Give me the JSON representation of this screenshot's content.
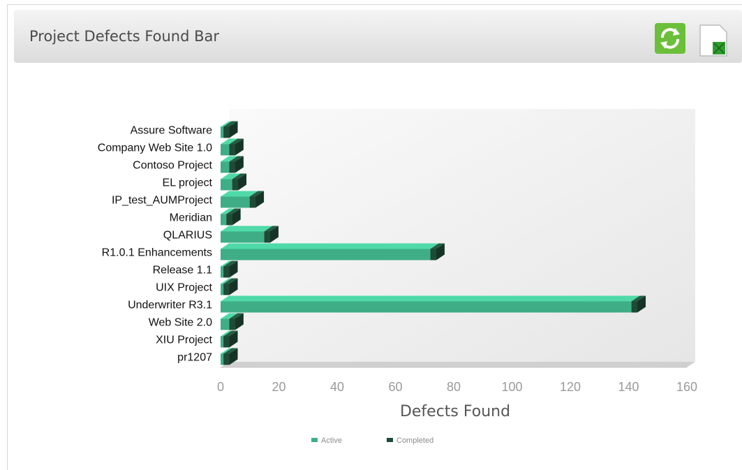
{
  "panel": {
    "title": "Project Defects Found Bar",
    "refresh_icon": "refresh-icon",
    "export_icon": "excel-export-icon"
  },
  "chart_data": {
    "type": "bar",
    "orientation": "horizontal",
    "stacked": true,
    "title": "Project Defects Found Bar",
    "xlabel": "Defects Found",
    "ylabel": "",
    "xlim": [
      0,
      160
    ],
    "xticks": [
      0,
      20,
      40,
      60,
      80,
      100,
      120,
      140,
      160
    ],
    "categories": [
      "Assure Software",
      "Company Web Site 1.0",
      "Contoso Project",
      "EL project",
      "IP_test_AUMProject",
      "Meridian",
      "QLARIUS",
      "R1.0.1 Enhancements",
      "Release 1.1",
      "UIX Project",
      "Underwriter R3.1",
      "Web Site 2.0",
      "XIU Project",
      "pr1207"
    ],
    "series": [
      {
        "name": "Active",
        "color": "#3fae86",
        "values": [
          1,
          3,
          3,
          4,
          10,
          2,
          15,
          72,
          1,
          1,
          141,
          3,
          1,
          1
        ]
      },
      {
        "name": "Completed",
        "color": "#1f4a35",
        "values": [
          2,
          2,
          2,
          2,
          2,
          2,
          2,
          2,
          2,
          2,
          2,
          2,
          2,
          2
        ]
      }
    ],
    "legend": "bottom",
    "grid": false,
    "style": "3d"
  }
}
